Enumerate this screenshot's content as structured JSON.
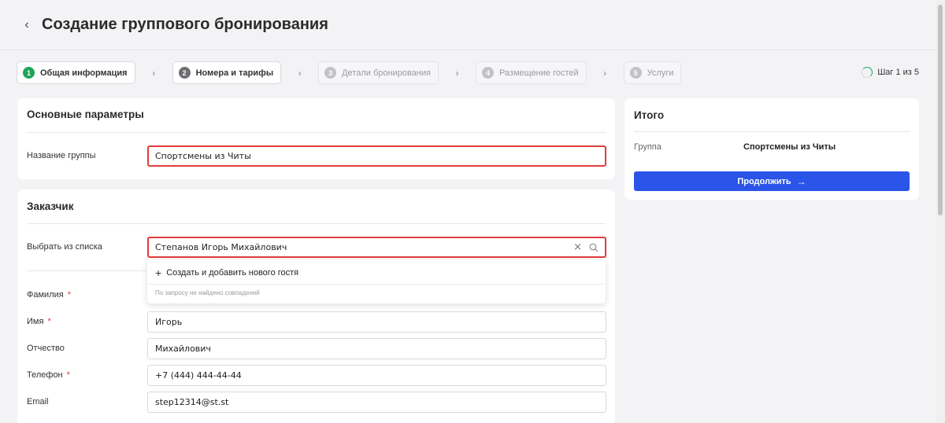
{
  "header": {
    "back_icon": "chevron-left-icon",
    "title": "Создание группового бронирования"
  },
  "steps": [
    {
      "num": "1",
      "label": "Общая информация"
    },
    {
      "num": "2",
      "label": "Номера и тарифы"
    },
    {
      "num": "3",
      "label": "Детали бронирования"
    },
    {
      "num": "4",
      "label": "Размещение гостей"
    },
    {
      "num": "5",
      "label": "Услуги"
    }
  ],
  "step_counter": "Шаг 1 из 5",
  "step_progress": 0.2,
  "main_params": {
    "title": "Основные параметры",
    "group_name_label": "Название группы",
    "group_name_value": "Спортсмены из Читы"
  },
  "customer": {
    "title": "Заказчик",
    "select_label": "Выбрать из списка",
    "select_value": "Степанов Игорь Михайлович",
    "dropdown": {
      "add_label": "Создать и добавить нового гостя",
      "empty_label": "По запросу не найдено совпадений"
    },
    "fields": {
      "last_name_label": "Фамилия",
      "first_name_label": "Имя",
      "first_name_value": "Игорь",
      "middle_name_label": "Отчество",
      "middle_name_value": "Михайлович",
      "phone_label": "Телефон",
      "phone_value": "+7 (444) 444-44-44",
      "email_label": "Email",
      "email_value": "step12314@st.st"
    },
    "required_mark": "*"
  },
  "summary": {
    "title": "Итого",
    "group_label": "Группа",
    "group_value": "Спортсмены из Читы",
    "continue_label": "Продолжить"
  },
  "colors": {
    "accent": "#2b55e8",
    "active_step": "#1ea55a",
    "error": "#e23b3b"
  }
}
